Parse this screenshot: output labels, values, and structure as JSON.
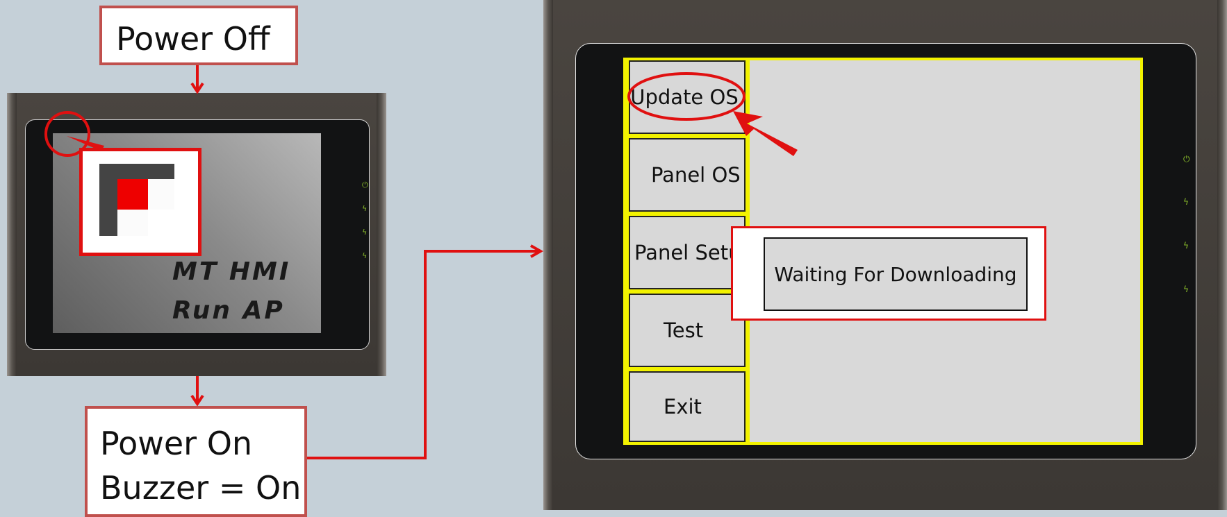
{
  "callouts": {
    "power_off": "Power Off",
    "power_on_line1": "Power On",
    "power_on_line2": "Buzzer = On"
  },
  "small_hmi": {
    "screen_line1": "MT HMI",
    "screen_line2": "Run AP",
    "leds": [
      "power-led-icon",
      "status-led-icon",
      "status-led-icon",
      "status-led-icon"
    ]
  },
  "big_hmi": {
    "menu": [
      {
        "label": "Update OS"
      },
      {
        "label": "Panel OS"
      },
      {
        "label": "Panel Setup"
      },
      {
        "label": "Test"
      },
      {
        "label": "Exit"
      }
    ],
    "dialog_text": "Waiting For Downloading"
  },
  "colors": {
    "annotation_red": "#e01010",
    "highlight_yellow": "#f2f200",
    "led_green": "#8cbf2a"
  }
}
